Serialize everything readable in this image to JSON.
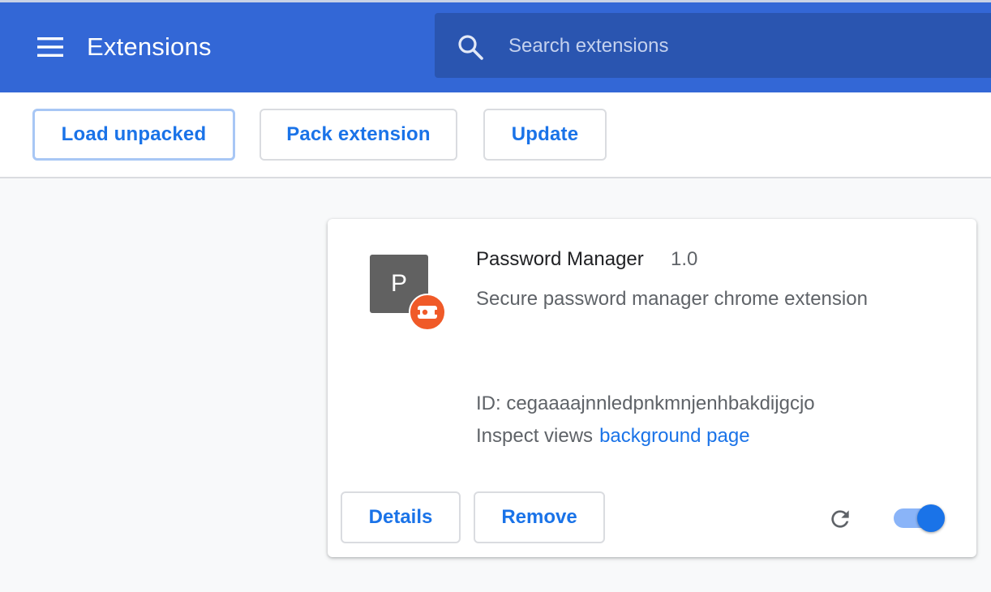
{
  "header": {
    "title": "Extensions",
    "menu_icon": "hamburger-menu-icon",
    "search_icon": "search-icon",
    "search_placeholder": "Search extensions",
    "search_value": ""
  },
  "toolbar": {
    "load_unpacked_label": "Load unpacked",
    "pack_extension_label": "Pack extension",
    "update_label": "Update"
  },
  "extension": {
    "icon_letter": "P",
    "badge_icon": "unpacked-extension-icon",
    "name": "Password Manager",
    "version": "1.0",
    "description": "Secure password manager chrome extension",
    "id_text": "ID: cegaaaajnnledpnkmnjenhbakdijgcjo",
    "inspect_label": "Inspect views",
    "inspect_link": "background page",
    "details_label": "Details",
    "remove_label": "Remove",
    "reload_icon": "reload-icon",
    "enabled": true
  },
  "colors": {
    "header_bg": "#3367d6",
    "search_bg": "#2a55b0",
    "accent": "#1a73e8",
    "toggle_track": "#8ab4f8",
    "badge": "#f05a28"
  }
}
